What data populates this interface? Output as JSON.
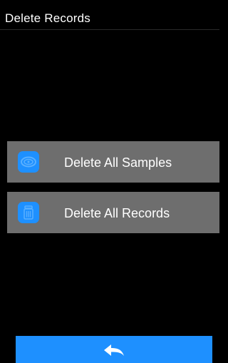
{
  "header": {
    "title": "Delete Records"
  },
  "menu": {
    "items": [
      {
        "label": "Delete All Samples",
        "icon": "samples-icon"
      },
      {
        "label": "Delete All Records",
        "icon": "trash-icon"
      }
    ]
  },
  "footer": {
    "back_icon": "back-arrow-icon"
  },
  "colors": {
    "background": "#000000",
    "item_background": "#6e6e6e",
    "accent": "#1e90ff",
    "text": "#ffffff"
  }
}
